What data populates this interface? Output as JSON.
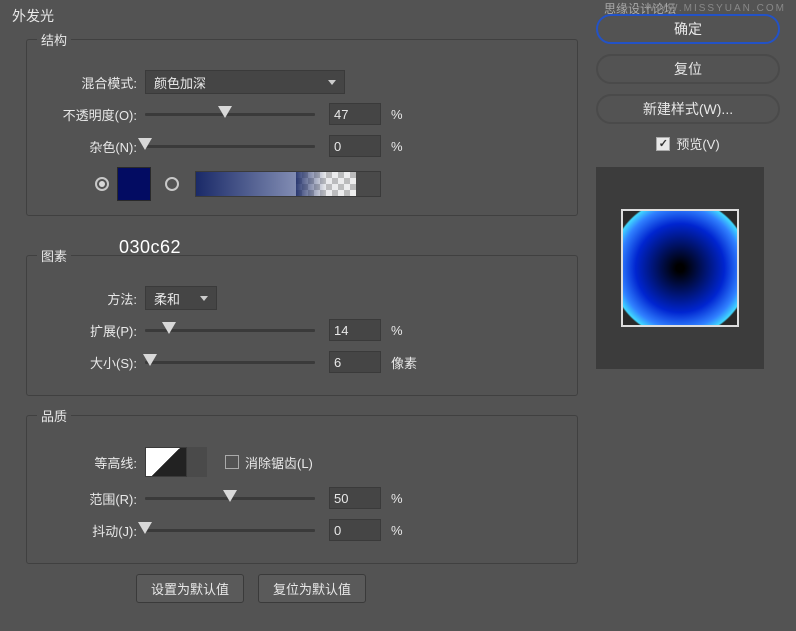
{
  "watermark_cn": "思缘设计论坛",
  "watermark_en": "WWW.MISSYUAN.COM",
  "title": "外发光",
  "structure": {
    "legend": "结构",
    "blendMode": {
      "label": "混合模式:",
      "value": "颜色加深"
    },
    "opacity": {
      "label": "不透明度(O):",
      "value": "47",
      "unit": "%",
      "pct": 47
    },
    "noise": {
      "label": "杂色(N):",
      "value": "0",
      "unit": "%",
      "pct": 0
    },
    "color_hex": "030c62"
  },
  "elements": {
    "legend": "图素",
    "technique": {
      "label": "方法:",
      "value": "柔和"
    },
    "spread": {
      "label": "扩展(P):",
      "value": "14",
      "unit": "%",
      "pct": 14
    },
    "size": {
      "label": "大小(S):",
      "value": "6",
      "unit": "像素",
      "pct": 3
    }
  },
  "quality": {
    "legend": "品质",
    "contour": {
      "label": "等高线:"
    },
    "antiAlias": {
      "label": "消除锯齿(L)",
      "checked": false
    },
    "range": {
      "label": "范围(R):",
      "value": "50",
      "unit": "%",
      "pct": 50
    },
    "jitter": {
      "label": "抖动(J):",
      "value": "0",
      "unit": "%",
      "pct": 0
    }
  },
  "buttons": {
    "makeDefault": "设置为默认值",
    "resetDefault": "复位为默认值"
  },
  "right": {
    "ok": "确定",
    "cancel": "复位",
    "newStyle": "新建样式(W)...",
    "preview": "预览(V)"
  }
}
